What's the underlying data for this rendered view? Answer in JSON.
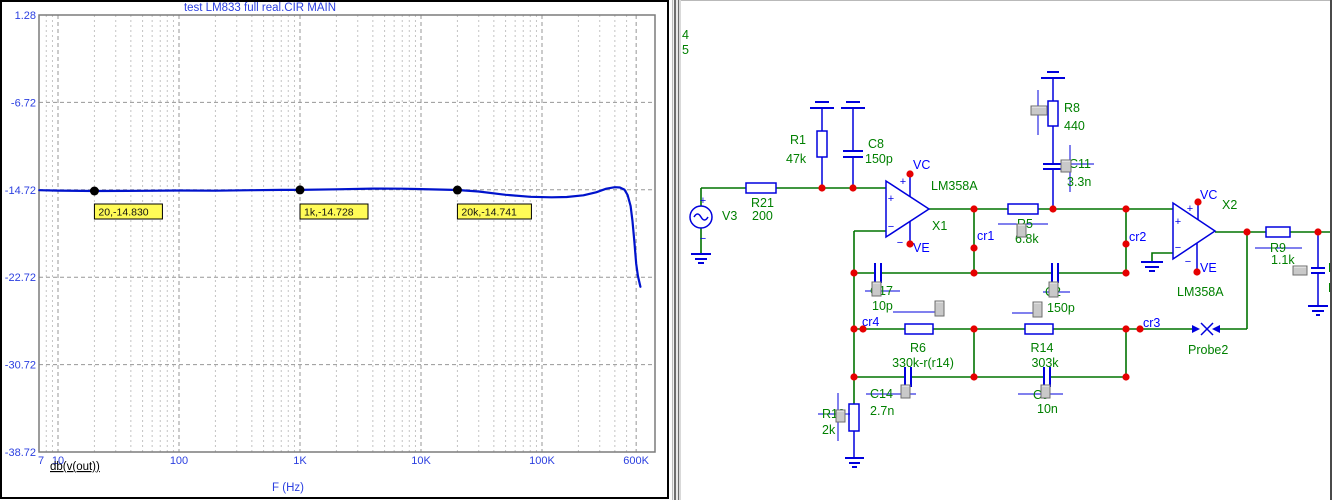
{
  "chart": {
    "title": "test LM833 full real.CIR MAIN",
    "trace_label": "db(v(out))",
    "xlabel": "F (Hz)"
  },
  "chart_data": {
    "type": "line",
    "xscale": "log",
    "title": "test LM833 full real.CIR MAIN",
    "xlabel": "F (Hz)",
    "ylabel": "db(v(out))",
    "xlim": [
      7,
      600000
    ],
    "ylim": [
      -38.72,
      1.28
    ],
    "grid": true,
    "x": [
      7,
      10,
      20,
      50,
      100,
      200,
      400,
      700,
      1000,
      2000,
      4000,
      7000,
      10000,
      15000,
      20000,
      30000,
      50000,
      80000,
      120000,
      160000,
      220000,
      280000,
      340000,
      400000,
      440000,
      480000,
      510000,
      540000,
      560000,
      580000,
      600000,
      620000,
      650000
    ],
    "y": [
      -14.76,
      -14.79,
      -14.83,
      -14.81,
      -14.78,
      -14.8,
      -14.76,
      -14.73,
      -14.728,
      -14.67,
      -14.61,
      -14.62,
      -14.66,
      -14.7,
      -14.741,
      -14.88,
      -15.18,
      -15.36,
      -15.41,
      -15.38,
      -15.22,
      -14.95,
      -14.62,
      -14.48,
      -14.51,
      -14.7,
      -15.2,
      -16.2,
      -17.6,
      -19.5,
      -21.5,
      -22.6,
      -23.6
    ],
    "markers": [
      {
        "f": 20,
        "db": -14.83,
        "label": "20,-14.830"
      },
      {
        "f": 1000,
        "db": -14.728,
        "label": "1k,-14.728"
      },
      {
        "f": 20000,
        "db": -14.741,
        "label": "20k,-14.741"
      }
    ],
    "x_ticks": [
      {
        "f": 7,
        "label": "7"
      },
      {
        "f": 10,
        "label": "10"
      },
      {
        "f": 100,
        "label": "100"
      },
      {
        "f": 1000,
        "label": "1K"
      },
      {
        "f": 10000,
        "label": "10K"
      },
      {
        "f": 100000,
        "label": "100K"
      },
      {
        "f": 600000,
        "label": "600K"
      }
    ],
    "y_ticks": [
      {
        "db": 1.28,
        "label": "1.28"
      },
      {
        "db": -6.72,
        "label": "-6.72"
      },
      {
        "db": -14.72,
        "label": "-14.72"
      },
      {
        "db": -22.72,
        "label": "-22.72"
      },
      {
        "db": -30.72,
        "label": "-30.72"
      },
      {
        "db": -38.72,
        "label": "-38.72"
      }
    ]
  },
  "colors": {
    "curve": "#0013cc",
    "axis_text": "#2b3fe0",
    "tag_bg": "#fffb57",
    "wire": "#007300",
    "component": "#0000dd",
    "label_green": "#008000",
    "node_blue": "#0000ff",
    "junction": "#e60000"
  },
  "schematic": {
    "grid_rows": [
      "4",
      "5"
    ],
    "v3": {
      "name": "V3",
      "plus": "+",
      "minus": "−"
    },
    "r21": {
      "name": "R21",
      "value": "200"
    },
    "r1": {
      "name": "R1",
      "value": "47k"
    },
    "c8": {
      "name": "C8",
      "value": "150p"
    },
    "x1": {
      "designator": "X1",
      "model": "LM358A",
      "plus": "+",
      "minus": "−"
    },
    "x2": {
      "designator": "X2",
      "model": "LM358A",
      "plus": "+",
      "minus": "−"
    },
    "r8": {
      "name": "R8",
      "value": "440"
    },
    "c11": {
      "name": "C11",
      "value": "3.3n"
    },
    "r5": {
      "name": "R5",
      "value": "6.8k"
    },
    "r9": {
      "name": "R9",
      "value": "1.1k"
    },
    "c17": {
      "name": "C17",
      "value": "10p"
    },
    "c2": {
      "name": "C2",
      "value": "150p"
    },
    "r6": {
      "name": "R6",
      "value": "330k-r(r14)"
    },
    "r14": {
      "name": "R14",
      "value": "303k"
    },
    "c14": {
      "name": "C14",
      "value": "2.7n"
    },
    "c9": {
      "name": "C9",
      "value": "10n"
    },
    "r13": {
      "name": "R13",
      "value": "2k"
    },
    "probe": {
      "name": "Probe2"
    },
    "nodes": {
      "vc": "VC",
      "ve": "VE",
      "cr1": "cr1",
      "cr2": "cr2",
      "cr3": "cr3",
      "cr4": "cr4"
    }
  }
}
